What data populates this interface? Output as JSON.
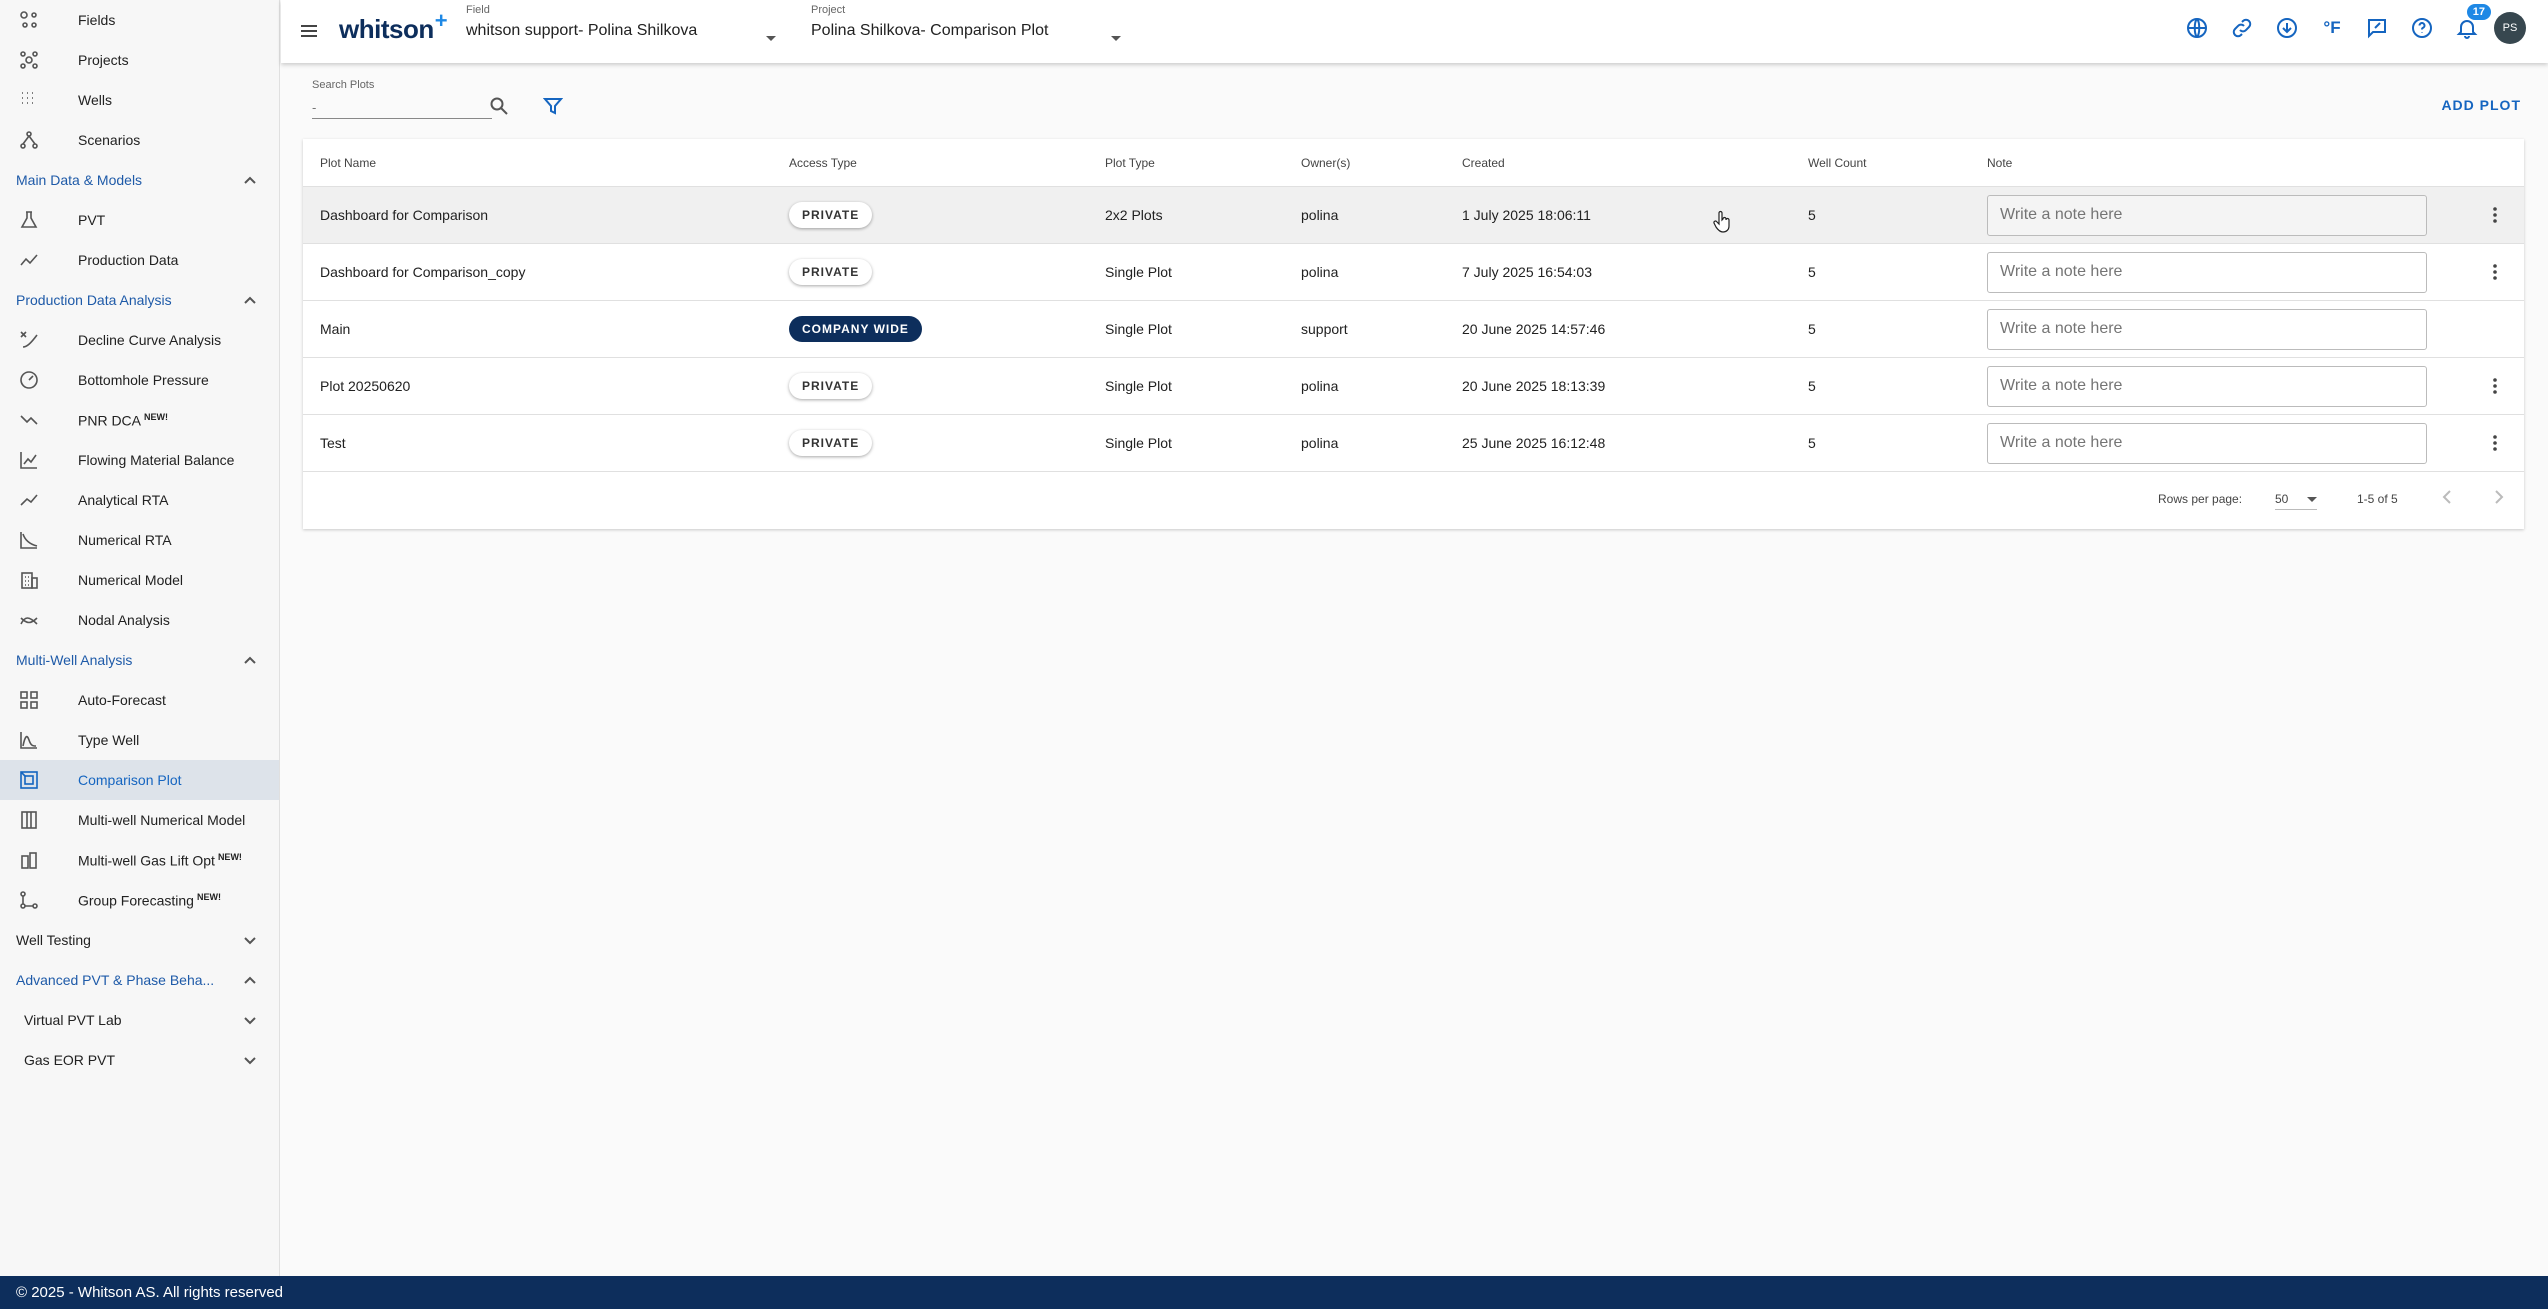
{
  "sidebar": {
    "top_items": [
      {
        "label": "Fields",
        "icon": "fields-icon"
      },
      {
        "label": "Projects",
        "icon": "projects-icon"
      },
      {
        "label": "Wells",
        "icon": "wells-icon"
      },
      {
        "label": "Scenarios",
        "icon": "scenarios-icon"
      }
    ],
    "sections": {
      "main_data": "Main Data & Models",
      "production_data_analysis": "Production Data Analysis",
      "multi_well": "Multi-Well Analysis",
      "well_testing": "Well Testing",
      "advanced_pvt": "Advanced PVT & Phase Beha...",
      "virtual_pvt_lab": "Virtual PVT Lab",
      "gas_eor_pvt": "Gas EOR PVT"
    },
    "main_data_items": [
      {
        "label": "PVT",
        "new": ""
      },
      {
        "label": "Production Data",
        "new": ""
      }
    ],
    "pda_items": [
      {
        "label": "Decline Curve Analysis",
        "new": ""
      },
      {
        "label": "Bottomhole Pressure",
        "new": ""
      },
      {
        "label": "PNR DCA",
        "new": "NEW!"
      },
      {
        "label": "Flowing Material Balance",
        "new": ""
      },
      {
        "label": "Analytical RTA",
        "new": ""
      },
      {
        "label": "Numerical RTA",
        "new": ""
      },
      {
        "label": "Numerical Model",
        "new": ""
      },
      {
        "label": "Nodal Analysis",
        "new": ""
      }
    ],
    "mwa_items": [
      {
        "label": "Auto-Forecast",
        "new": ""
      },
      {
        "label": "Type Well",
        "new": ""
      },
      {
        "label": "Comparison Plot",
        "new": ""
      },
      {
        "label": "Multi-well Numerical Model",
        "new": ""
      },
      {
        "label": "Multi-well Gas Lift Opt",
        "new": "NEW!"
      },
      {
        "label": "Group Forecasting",
        "new": "NEW!"
      }
    ]
  },
  "topbar": {
    "logo": "whitson",
    "logo_plus": "+",
    "field_caption": "Field",
    "field_value": "whitson support- Polina Shilkova",
    "project_caption": "Project",
    "project_value": "Polina Shilkova- Comparison Plot",
    "unit_label": "°F",
    "notification_count": "17",
    "avatar_initials": "PS"
  },
  "toolbar": {
    "search_label": "Search Plots",
    "search_placeholder": "-",
    "add_plot_label": "ADD PLOT"
  },
  "table": {
    "headers": {
      "name": "Plot Name",
      "access": "Access Type",
      "type": "Plot Type",
      "owner": "Owner(s)",
      "created": "Created",
      "well_count": "Well Count",
      "note": "Note"
    },
    "note_placeholder": "Write a note here",
    "rows": [
      {
        "name": "Dashboard for Comparison",
        "access": "PRIVATE",
        "type": "2x2 Plots",
        "owner": "polina",
        "created": "1 July 2025 18:06:11",
        "well_count": "5"
      },
      {
        "name": "Dashboard for Comparison_copy",
        "access": "PRIVATE",
        "type": "Single Plot",
        "owner": "polina",
        "created": "7 July 2025 16:54:03",
        "well_count": "5"
      },
      {
        "name": "Main",
        "access": "COMPANY WIDE",
        "type": "Single Plot",
        "owner": "support",
        "created": "20 June 2025 14:57:46",
        "well_count": "5"
      },
      {
        "name": "Plot 20250620",
        "access": "PRIVATE",
        "type": "Single Plot",
        "owner": "polina",
        "created": "20 June 2025 18:13:39",
        "well_count": "5"
      },
      {
        "name": "Test",
        "access": "PRIVATE",
        "type": "Single Plot",
        "owner": "polina",
        "created": "25 June 2025 16:12:48",
        "well_count": "5"
      }
    ]
  },
  "pager": {
    "rows_per_page_label": "Rows per page:",
    "rows_per_page_value": "50",
    "range": "1-5 of 5"
  },
  "footer": {
    "text": "© 2025 - Whitson AS. All rights reserved"
  },
  "colors": {
    "brand_navy": "#0d2e5c",
    "accent_blue": "#1565c0",
    "active_bg": "#dde3ea"
  }
}
